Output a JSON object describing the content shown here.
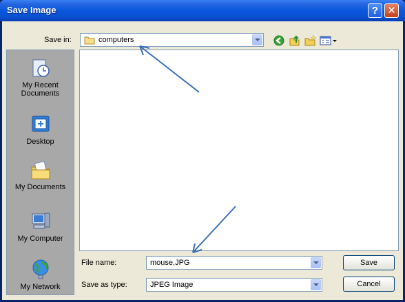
{
  "window": {
    "title": "Save Image",
    "help_label": "?",
    "close_label": "✕"
  },
  "save_in": {
    "label": "Save in:",
    "value": "computers",
    "icon": "folder-icon"
  },
  "toolbar": {
    "icons": [
      "back-icon",
      "up-folder-icon",
      "new-folder-icon",
      "views-menu-icon"
    ]
  },
  "places": [
    {
      "label": "My Recent Documents",
      "icon": "recent-documents-icon"
    },
    {
      "label": "Desktop",
      "icon": "desktop-icon"
    },
    {
      "label": "My Documents",
      "icon": "my-documents-icon"
    },
    {
      "label": "My Computer",
      "icon": "my-computer-icon"
    },
    {
      "label": "My Network",
      "icon": "my-network-icon"
    }
  ],
  "file_name": {
    "label": "File name:",
    "value": "mouse.JPG"
  },
  "save_as_type": {
    "label": "Save as type:",
    "value": "JPEG Image"
  },
  "buttons": {
    "save": "Save",
    "cancel": "Cancel"
  },
  "colors": {
    "title_bar": "#0a57dd",
    "dialog_bg": "#ece9d8",
    "places_bg": "#a8a8a8",
    "annotation_arrow": "#3a6fb5"
  }
}
